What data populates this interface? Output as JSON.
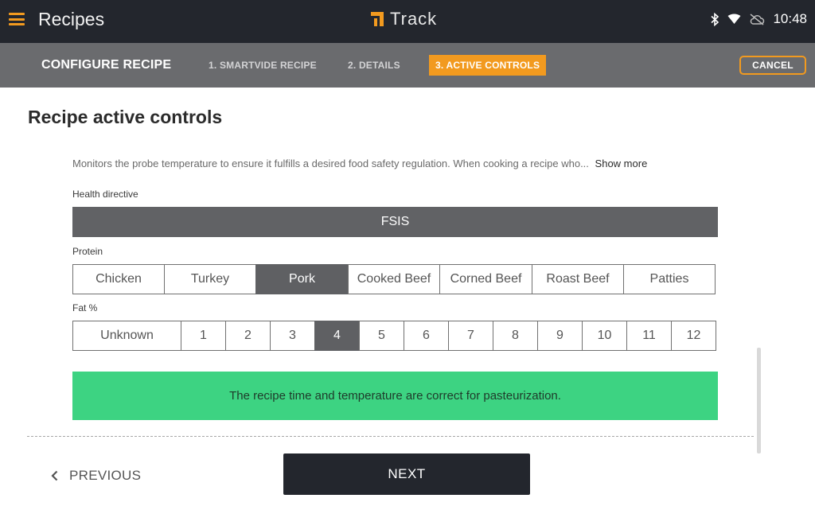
{
  "topbar": {
    "title": "Recipes",
    "brand": "Track",
    "time": "10:48",
    "brand_color": "#f29a1f"
  },
  "steps": {
    "title": "CONFIGURE RECIPE",
    "items": [
      {
        "label": "1. SMARTVIDE RECIPE",
        "active": false
      },
      {
        "label": "2. DETAILS",
        "active": false
      },
      {
        "label": "3. ACTIVE CONTROLS",
        "active": true
      }
    ],
    "cancel_label": "CANCEL"
  },
  "main": {
    "heading": "Recipe active controls",
    "description": "Monitors the probe temperature to ensure it fulfills a desired food safety regulation. When cooking a recipe who...",
    "show_more": "Show more",
    "health_directive": {
      "label": "Health directive",
      "value": "FSIS"
    },
    "protein": {
      "label": "Protein",
      "options": [
        "Chicken",
        "Turkey",
        "Pork",
        "Cooked Beef",
        "Corned Beef",
        "Roast Beef",
        "Patties"
      ],
      "selected": "Pork"
    },
    "fat": {
      "label": "Fat %",
      "options": [
        "Unknown",
        "1",
        "2",
        "3",
        "4",
        "5",
        "6",
        "7",
        "8",
        "9",
        "10",
        "11",
        "12"
      ],
      "selected": "4"
    },
    "notice": "The recipe time and temperature are correct for pasteurization.",
    "notice_color": "#3dd382"
  },
  "footer": {
    "previous_label": "PREVIOUS",
    "next_label": "NEXT"
  }
}
